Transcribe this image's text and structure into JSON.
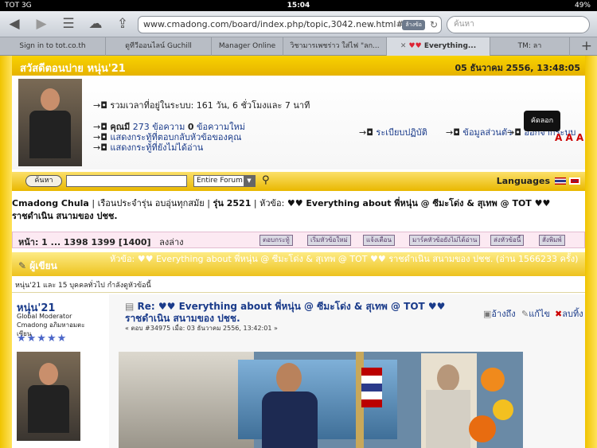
{
  "statusbar": {
    "carrier": "TOT 3G",
    "time": "15:04",
    "battery": "49%"
  },
  "browser": {
    "url": "www.cmadong.com/board/index.php/topic,3042.new.html#new",
    "url_badge": "ล้างข้อ",
    "search_placeholder": "ค้นหา",
    "tabs": [
      {
        "label": "Sign in to tot.co.th"
      },
      {
        "label": "ดูทีวีออนไลน์ Guchill"
      },
      {
        "label": "Manager Online"
      },
      {
        "label": "วิชามารเพชร่าว ใส่ไฟ \"ลก..."
      },
      {
        "label": "Everything..."
      },
      {
        "label": "TM: ลา"
      }
    ]
  },
  "header": {
    "greeting": "สวัสดีตอนบ่าย หนุ่น'21",
    "date": "05 ธันวาคม 2556, 13:48:05"
  },
  "userinfo": {
    "time_online": "รวมเวลาที่อยู่ในระบบ: 161 วัน, 6 ชั่วโมงและ 7 นาที",
    "posts_prefix": "คุณมี",
    "posts_count": "273",
    "posts_word": "ข้อความ",
    "new_count": "0",
    "new_word": "ข้อความใหม่",
    "link_replies": "แสดงกระทู้ที่ตอบกลับหัวข้อของคุณ",
    "link_unread": "แสดงกระทู้ที่ยังไม่ได้อ่าน",
    "link_calendar": "ระเบียบปฏิบัติ",
    "link_profile": "ข้อมูลส่วนตัว",
    "link_logout": "ออกจากระบบ",
    "copy_popup": "คัดลอก",
    "font_sizer": "A A A"
  },
  "searchbar": {
    "button": "ค้นหา",
    "select": "Entire Forum",
    "languages": "Languages"
  },
  "breadcrumb": {
    "site": "Cmadong Chula",
    "sep1": "|",
    "board": "เรือนประจำรุ่น อบอุ่นทุกสมัย",
    "sep2": "|",
    "class": "รุ่น 2521",
    "sep3": "|",
    "topic_prefix": "หัวข้อ:",
    "topic": "♥♥ Everything about พี่หนุ่น @ ซีมะโด่ง & สุเทพ @ TOT ♥♥ ราชดำเนิน สนามของ ปชช."
  },
  "pagination": {
    "label": "หน้า: 1 ... 1398 1399 [1400]",
    "down": "ลงล่าง",
    "actions": [
      "ตอบกระทู้",
      "เริ่มหัวข้อใหม่",
      "แจ้งเตือน",
      "มาร์คหัวข้อยังไม่ได้อ่าน",
      "ส่งหัวข้อนี้",
      "สั่งพิมพ์"
    ]
  },
  "thread": {
    "author_label": "ผู้เขียน",
    "title": "หัวข้อ: ♥♥ Everything about พี่หนุ่น @ ซีมะโด่ง & สุเทพ @ TOT ♥♥ ราชดำเนิน สนามของ ปชช. (อ่าน 1566233 ครั้ง)",
    "viewers": "หนุ่น'21 และ 15 บุคคลทั่วไป กำลังดูหัวข้อนี้"
  },
  "post": {
    "author": "หนุ่น'21",
    "role": "Global Moderator",
    "rank": "Cmadong อภิมหาอมตะเซียน",
    "stars": "★★★★★",
    "title": "Re: ♥♥ Everything about พี่หนุ่น @ ซีมะโด่ง & สุเทพ @ TOT ♥♥ ราชดำเนิน สนามของ ปชช.",
    "meta": "« ตอบ #34975 เมื่อ: 03 ธันวาคม 2556, 13:42:01 »",
    "quote": "อ้างถึง",
    "edit": "แก้ไข",
    "delete": "ลบทิ้ง"
  }
}
